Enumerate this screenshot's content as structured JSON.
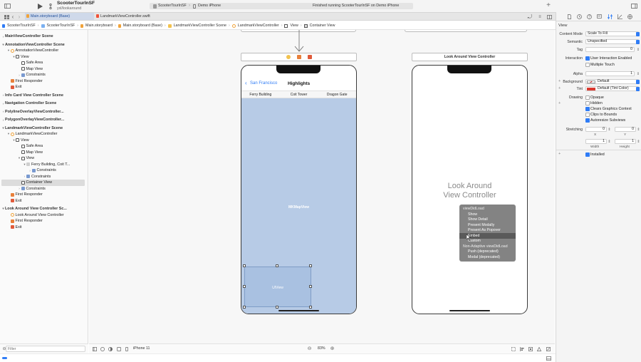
{
  "colors": {
    "accent": "#2f7cf6",
    "selection": "#dcdcdc",
    "map_fill": "#b7cbe6",
    "uiview_fill": "#a9c1e1",
    "menu_bg": "#7a7a7a",
    "tint": "#d9392f",
    "storyboard_icon": "#f0a33a"
  },
  "toolbar": {
    "project_name": "ScooterTourInSF",
    "branch": "yxl/lookaround",
    "scheme": "ScooterTourInSF",
    "device": "Demo iPhone",
    "status": "Finished running ScooterTourInSF on Demo iPhone"
  },
  "tabs": [
    {
      "label": "Main.storyboard (Base)",
      "active": true
    },
    {
      "label": "LandmarkViewController.swift",
      "active": false
    }
  ],
  "breadcrumbs": [
    "ScooterTourInSF",
    "ScooterTourInSF",
    "Main.storyboard",
    "Main.storyboard (Base)",
    "LandmarkViewController Scene",
    "LandmarkViewController",
    "View",
    "Container View"
  ],
  "outline": {
    "rows": [
      {
        "label": "MainViewController Scene",
        "type": "scene",
        "indent": 0,
        "expanded": false
      },
      {
        "label": "AnnotationViewController Scene",
        "type": "scene",
        "indent": 0,
        "expanded": true
      },
      {
        "label": "AnnotationViewController",
        "type": "vc",
        "indent": 1,
        "expanded": true
      },
      {
        "label": "View",
        "type": "view",
        "indent": 2,
        "expanded": true
      },
      {
        "label": "Safe Area",
        "type": "view",
        "indent": 3
      },
      {
        "label": "Map View",
        "type": "view",
        "indent": 3
      },
      {
        "label": "Constraints",
        "type": "constraint",
        "indent": 3,
        "expanded": false
      },
      {
        "label": "First Responder",
        "type": "responder",
        "indent": 1
      },
      {
        "label": "Exit",
        "type": "exit",
        "indent": 1
      },
      {
        "label": "Info Card View Controller Scene",
        "type": "scene",
        "indent": 0,
        "expanded": false
      },
      {
        "label": "Navigation Controller Scene",
        "type": "scene",
        "indent": 0,
        "expanded": false
      },
      {
        "label": "PolylineOverlayViewController...",
        "type": "scene",
        "indent": 0,
        "expanded": false
      },
      {
        "label": "PolygonOverlayViewController...",
        "type": "scene",
        "indent": 0,
        "expanded": false
      },
      {
        "label": "LandmarkViewController Scene",
        "type": "scene",
        "indent": 0,
        "expanded": true
      },
      {
        "label": "LandmarkViewController",
        "type": "vc",
        "indent": 1,
        "expanded": true
      },
      {
        "label": "View",
        "type": "view",
        "indent": 2,
        "expanded": true
      },
      {
        "label": "Safe Area",
        "type": "view",
        "indent": 3
      },
      {
        "label": "Map View",
        "type": "view",
        "indent": 3
      },
      {
        "label": "View",
        "type": "view",
        "indent": 3,
        "expanded": true
      },
      {
        "label": "Ferry Building, Coit T...",
        "type": "segment",
        "indent": 4,
        "expanded": true
      },
      {
        "label": "Constraints",
        "type": "constraint",
        "indent": 5,
        "expanded": false
      },
      {
        "label": "Constraints",
        "type": "constraint",
        "indent": 4,
        "expanded": false
      },
      {
        "label": "Container View",
        "type": "view",
        "indent": 3,
        "selected": true
      },
      {
        "label": "Constraints",
        "type": "constraint",
        "indent": 3,
        "expanded": false
      },
      {
        "label": "First Responder",
        "type": "responder",
        "indent": 1
      },
      {
        "label": "Exit",
        "type": "exit",
        "indent": 1
      },
      {
        "label": "Look Around View Controller Sc...",
        "type": "scene",
        "indent": 0,
        "expanded": true
      },
      {
        "label": "Look Around View Controller",
        "type": "vc",
        "indent": 1
      },
      {
        "label": "First Responder",
        "type": "responder",
        "indent": 1
      },
      {
        "label": "Exit",
        "type": "exit",
        "indent": 1
      }
    ]
  },
  "filter_placeholder": "Filter",
  "canvas": {
    "landmark_phone": {
      "nav_back": "San Francisco",
      "nav_title": "Highlights",
      "segments": [
        "Ferry Building",
        "Coit Tower",
        "Dragon Gate"
      ],
      "map_label": "MKMapView",
      "uiview_label": "UIView"
    },
    "lookaround_scene_title": "Look Around View Controller",
    "lookaround_phone": {
      "title_line1": "Look Around",
      "title_line2": "View Controller"
    },
    "segue_menu": {
      "items": [
        {
          "label": "viewDidLoad",
          "section": true
        },
        {
          "label": "Show"
        },
        {
          "label": "Show Detail"
        },
        {
          "label": "Present Modally"
        },
        {
          "label": "Present As Popover"
        },
        {
          "label": "Embed",
          "highlighted": true
        },
        {
          "label": "Custom"
        },
        {
          "label": "Non-Adaptive viewDidLoad",
          "section": true
        },
        {
          "label": "Push (deprecated)"
        },
        {
          "label": "Modal (deprecated)"
        }
      ]
    }
  },
  "bottombar": {
    "device": "iPhone 11",
    "zoom": "83%"
  },
  "inspector": {
    "section_title": "View",
    "content_mode": {
      "label": "Content Mode",
      "value": "Scale To Fill"
    },
    "semantic": {
      "label": "Semantic",
      "value": "Unspecified"
    },
    "tag": {
      "label": "Tag",
      "value": "0"
    },
    "interaction": {
      "label": "Interaction",
      "options": [
        {
          "label": "User Interaction Enabled",
          "checked": true
        },
        {
          "label": "Multiple Touch",
          "checked": false
        }
      ]
    },
    "alpha": {
      "label": "Alpha",
      "value": "1"
    },
    "background": {
      "label": "Background",
      "value": "Default"
    },
    "tint": {
      "label": "Tint",
      "value": "Default (Tint Color)"
    },
    "drawing": {
      "label": "Drawing",
      "options": [
        {
          "label": "Opaque",
          "checked": false
        },
        {
          "label": "Hidden",
          "checked": false
        },
        {
          "label": "Clears Graphics Context",
          "checked": true
        },
        {
          "label": "Clips to Bounds",
          "checked": false
        },
        {
          "label": "Autoresize Subviews",
          "checked": true
        }
      ]
    },
    "stretching": {
      "label": "Stretching",
      "x": "0",
      "y": "0",
      "width": "1",
      "height": "1",
      "x_label": "X",
      "y_label": "Y",
      "width_label": "Width",
      "height_label": "Height"
    },
    "installed": {
      "label": "Installed",
      "checked": true
    }
  }
}
